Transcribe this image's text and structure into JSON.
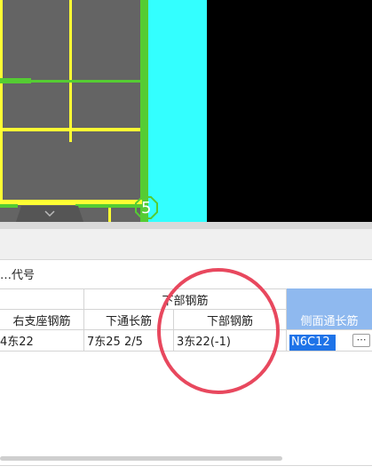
{
  "viewport": {
    "marker_label": "5",
    "colors": {
      "background": "#000000",
      "panel": "#646464",
      "beam": "#ffff33",
      "column": "#33ffff",
      "rebar": "#55cc33"
    }
  },
  "panel": {
    "title": "…代号",
    "group_header": "下部钢筋",
    "columns": [
      "右支座钢筋",
      "下通长筋",
      "下部钢筋",
      "侧面通长筋"
    ],
    "row": [
      "4东22",
      "7东25 2/5",
      "3东22(-1)",
      "N6C12"
    ],
    "edit_button": "⋯",
    "colors": {
      "selected_header": "#8fb9ef",
      "selection": "#1e73e8",
      "annotation": "#e8485e"
    }
  }
}
